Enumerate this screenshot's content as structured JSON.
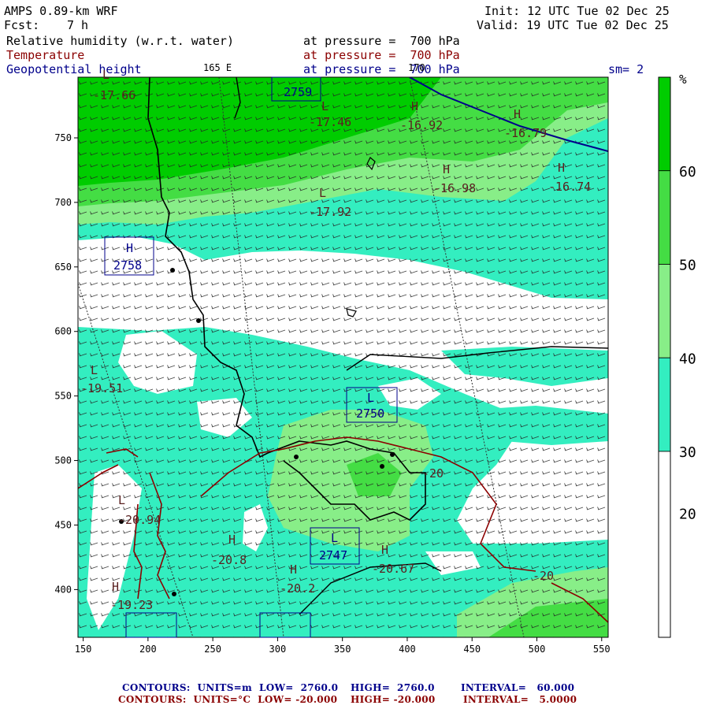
{
  "header": {
    "model": "AMPS 0.89-km WRF",
    "fcst_label": "Fcst:",
    "fcst_value": "7 h",
    "init": "Init: 12 UTC Tue 02 Dec 25",
    "valid": "Valid: 19 UTC Tue 02 Dec 25",
    "fields": [
      {
        "name": "Relative humidity (w.r.t. water)",
        "level": "at pressure =  700 hPa",
        "color": "#000000"
      },
      {
        "name": "Temperature",
        "level": "at pressure =  700 hPa",
        "color": "#8b0000"
      },
      {
        "name": "Geopotential height",
        "level": "at pressure =  700 hPa",
        "color": "#00008b"
      }
    ],
    "sm": "sm= 2",
    "lon_label_165": "165 E",
    "lon_label_170": "170"
  },
  "colorbar": {
    "unit": "%",
    "ticks": [
      "20",
      "30",
      "40",
      "50",
      "60"
    ],
    "bins": [
      {
        "from": 0,
        "to": 30,
        "color": "#ffffff"
      },
      {
        "from": 30,
        "to": 40,
        "color": "#33eec0"
      },
      {
        "from": 40,
        "to": 50,
        "color": "#88ee88"
      },
      {
        "from": 50,
        "to": 60,
        "color": "#44dd44"
      },
      {
        "from": 60,
        "to": 70,
        "color": "#00cc00"
      }
    ]
  },
  "axes": {
    "x_ticks": [
      "150",
      "200",
      "250",
      "300",
      "350",
      "400",
      "450",
      "500",
      "550"
    ],
    "y_ticks": [
      "400",
      "450",
      "500",
      "550",
      "600",
      "650",
      "700",
      "750"
    ]
  },
  "height_labels": [
    {
      "type": "H",
      "value": "2758"
    },
    {
      "type": "L",
      "value": "2759"
    },
    {
      "type": "L",
      "value": "2750"
    },
    {
      "type": "L",
      "value": "2747"
    }
  ],
  "temp_labels": [
    {
      "type": "L",
      "value": "-17.66"
    },
    {
      "type": "L",
      "value": "-17.46"
    },
    {
      "type": "H",
      "value": "-16.92"
    },
    {
      "type": "H",
      "value": "-16.79"
    },
    {
      "type": "H",
      "value": "-16.98"
    },
    {
      "type": "H",
      "value": "-16.74"
    },
    {
      "type": "L",
      "value": "-17.92"
    },
    {
      "type": "L",
      "value": "-19.51"
    },
    {
      "type": "L",
      "value": "-20.94"
    },
    {
      "type": "H",
      "value": "-20.8"
    },
    {
      "type": "H",
      "value": "-20.2"
    },
    {
      "type": "H",
      "value": "-20.67"
    },
    {
      "type": "H",
      "value": "-19.23"
    }
  ],
  "contour_values": [
    "-20",
    "-20"
  ],
  "footer": {
    "line1": {
      "label": "CONTOURS:  UNITS=m  LOW=  2760.0",
      "high": "HIGH=  2760.0",
      "interval": "INTERVAL=   60.000"
    },
    "line2": {
      "label": "CONTOURS:  UNITS=°C  LOW= -20.000",
      "high": "HIGH= -20.000",
      "interval": "INTERVAL=   5.0000"
    }
  }
}
